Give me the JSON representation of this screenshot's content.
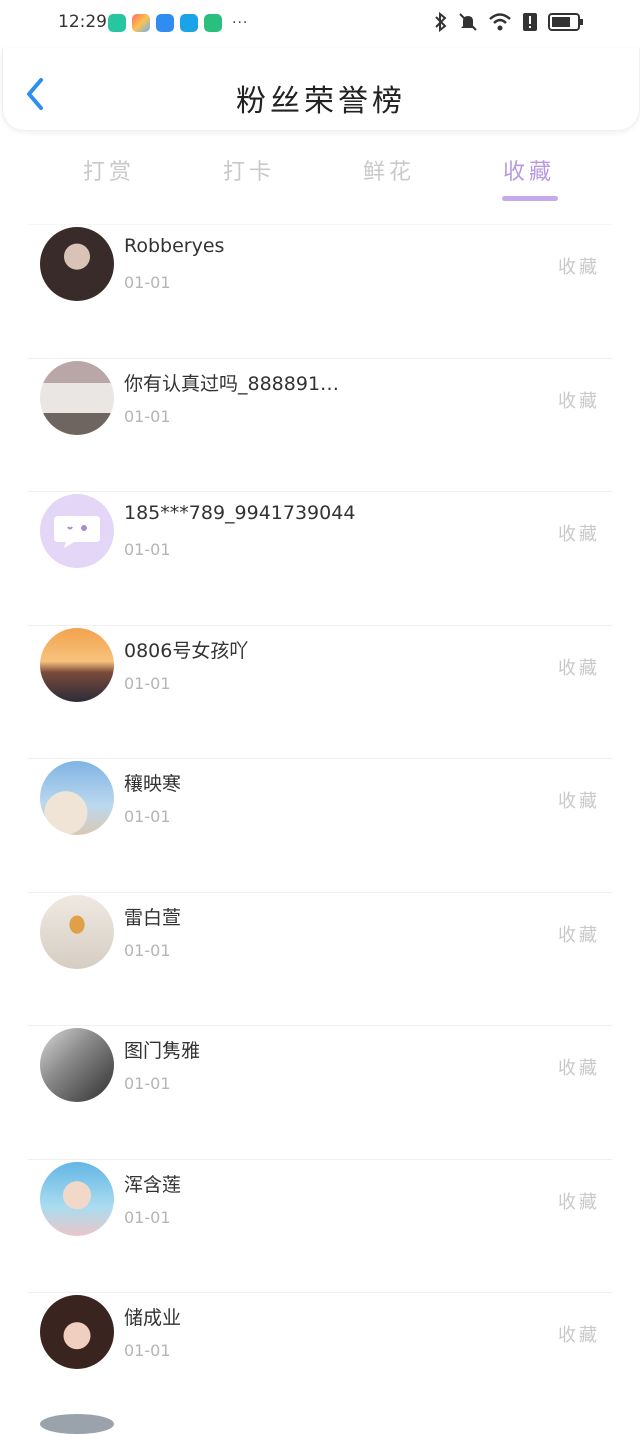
{
  "status": {
    "time": "12:29",
    "dots": "···"
  },
  "header": {
    "title": "粉丝荣誉榜"
  },
  "tabs": [
    {
      "label": "打赏"
    },
    {
      "label": "打卡"
    },
    {
      "label": "鲜花"
    },
    {
      "label": "收藏"
    }
  ],
  "active_tab": "收藏",
  "colors": {
    "accent": "#c6a9ea",
    "back": "#2b8ef0",
    "muted": "#c9c9c9"
  },
  "rows": [
    {
      "name": "Robberyes",
      "date": "01-01",
      "action": "收藏"
    },
    {
      "name": "你有认真过吗_888891…",
      "date": "01-01",
      "action": "收藏"
    },
    {
      "name": "185***789_9941739044",
      "date": "01-01",
      "action": "收藏"
    },
    {
      "name": "0806号女孩吖",
      "date": "01-01",
      "action": "收藏"
    },
    {
      "name": "穰映寒",
      "date": "01-01",
      "action": "收藏"
    },
    {
      "name": "雷白萱",
      "date": "01-01",
      "action": "收藏"
    },
    {
      "name": "图门隽雅",
      "date": "01-01",
      "action": "收藏"
    },
    {
      "name": "浑含莲",
      "date": "01-01",
      "action": "收藏"
    },
    {
      "name": "储成业",
      "date": "01-01",
      "action": "收藏"
    }
  ]
}
